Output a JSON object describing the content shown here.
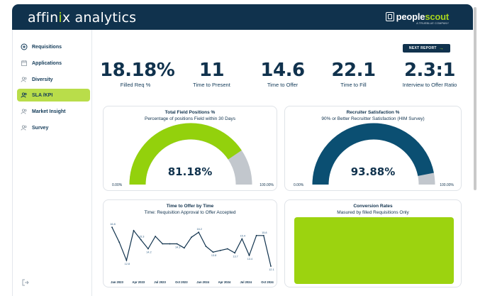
{
  "header": {
    "brand_prefix": "affin",
    "brand_accent": "i",
    "brand_mid": "x",
    "brand_suffix": " analytics",
    "partner_name_1": "people",
    "partner_name_2": "scout",
    "partner_tagline": "A TRUEBLUE COMPANY",
    "header_color": "#10324d",
    "accent_color": "#a6d41d"
  },
  "sidebar": {
    "items": [
      {
        "label": "Requisitions",
        "icon": "plus-circle-icon",
        "active": false
      },
      {
        "label": "Applications",
        "icon": "calendar-icon",
        "active": false
      },
      {
        "label": "Diversity",
        "icon": "users-icon",
        "active": false
      },
      {
        "label": "SLA /KPI",
        "icon": "users-icon",
        "active": true
      },
      {
        "label": "Market Insight",
        "icon": "users-icon",
        "active": false
      },
      {
        "label": "Survey",
        "icon": "users-icon",
        "active": false
      }
    ],
    "logout_icon": "logout-icon"
  },
  "toolbar": {
    "next_label": "NEXT REPORT"
  },
  "kpis": [
    {
      "value": "18.18%",
      "label": "Filled Req %"
    },
    {
      "value": "11",
      "label": "Time to Present"
    },
    {
      "value": "14.6",
      "label": "Time to Offer"
    },
    {
      "value": "22.1",
      "label": "Time to Fill"
    },
    {
      "value": "2.3:1",
      "label": "Interview to Offer Ratio"
    }
  ],
  "gauges": [
    {
      "title": "Total Field Positions %",
      "subtitle": "Percentage of positions Field within 30 Days",
      "value_text": "81.18%",
      "fraction": 0.8118,
      "min_label": "0.00%",
      "max_label": "100.00%",
      "color": "#93d10c",
      "track_color": "#c2c7cd"
    },
    {
      "title": "Recruiter Satisfaction %",
      "subtitle": "90% or Better Recruitter Satisfaction (HIM Survey)",
      "value_text": "93.88%",
      "fraction": 0.9388,
      "min_label": "0.00%",
      "max_label": "100.00%",
      "color": "#0b4f72",
      "track_color": "#c2c7cd"
    }
  ],
  "chart_data": [
    {
      "type": "line",
      "title": "Time to Offer by Time",
      "subtitle": "Time: Requisition Approval to Offer Accepted",
      "xlabel": "",
      "ylabel": "",
      "x_tick_labels": [
        "Jan 2023",
        "Apr 2023",
        "Jul 2023",
        "Oct 2023",
        "Jan 2024",
        "Apr 2024",
        "Jul 2024",
        "Oct 2024"
      ],
      "values": [
        16.8,
        15.0,
        12.8,
        16.4,
        15.3,
        14.2,
        15.7,
        14.8,
        14.8,
        14.8,
        14.3,
        15.6,
        16.2,
        14.5,
        13.8,
        14.0,
        14.2,
        13.7,
        15.4,
        13.4,
        15.8,
        15.8,
        12.1
      ],
      "data_labels": [
        {
          "index": 0,
          "text": "16.8"
        },
        {
          "index": 2,
          "text": "12.8"
        },
        {
          "index": 4,
          "text": "15.3"
        },
        {
          "index": 5,
          "text": "14.2"
        },
        {
          "index": 9,
          "text": "14.3"
        },
        {
          "index": 12,
          "text": "16.2"
        },
        {
          "index": 14,
          "text": "13.8"
        },
        {
          "index": 17,
          "text": "13.7"
        },
        {
          "index": 18,
          "text": "15.4"
        },
        {
          "index": 19,
          "text": "13.4"
        },
        {
          "index": 21,
          "text": "15.8"
        },
        {
          "index": 22,
          "text": "12.1"
        }
      ],
      "ylim": [
        11.5,
        17.5
      ],
      "grid": false,
      "color": "#10324d"
    },
    {
      "type": "bar",
      "title": "Conversion Rates",
      "subtitle": "Masured by filled Requisitions Only",
      "categories": [
        ""
      ],
      "values": [
        1
      ],
      "color": "#9cd30f"
    }
  ]
}
